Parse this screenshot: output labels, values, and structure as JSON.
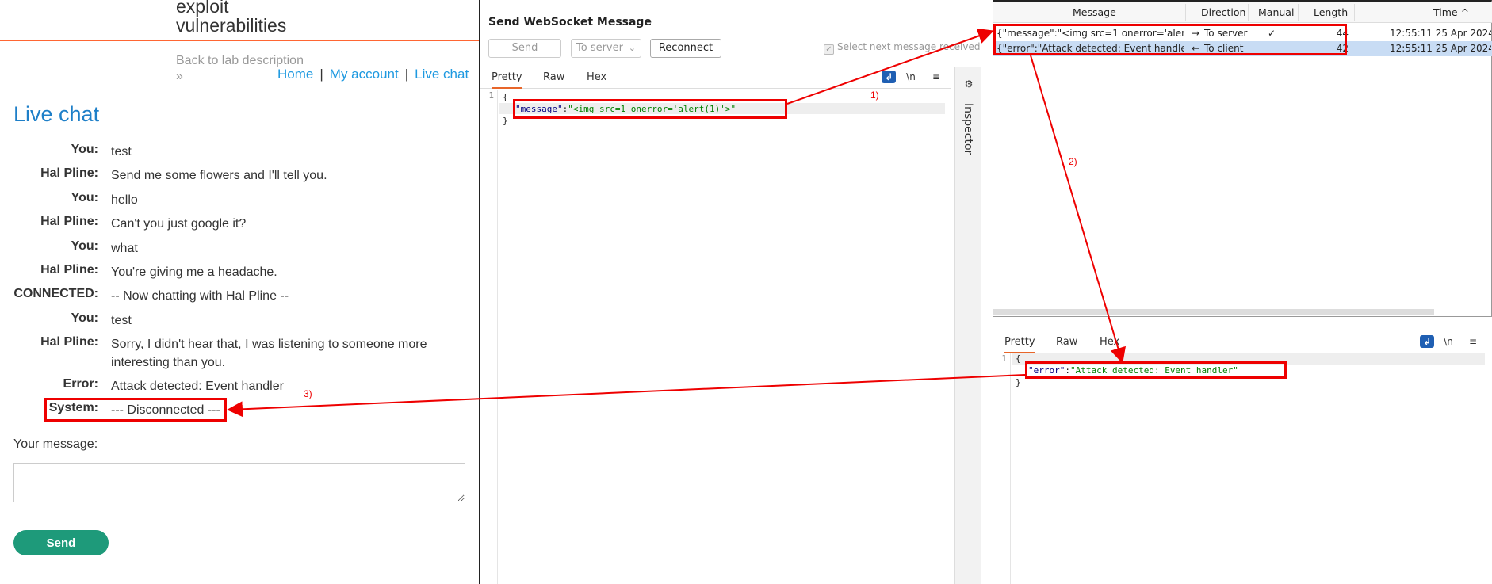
{
  "chat_page": {
    "lab_title_line1": "exploit",
    "lab_title_line2": "vulnerabilities",
    "back_link": "Back to lab description",
    "back_chevron": "»",
    "nav": {
      "home": "Home",
      "my_account": "My account",
      "live_chat": "Live chat",
      "separator": "|"
    },
    "live_chat_heading": "Live chat",
    "messages": [
      {
        "who": "You:",
        "text": "test"
      },
      {
        "who": "Hal Pline:",
        "text": "Send me some flowers and I'll tell you."
      },
      {
        "who": "You:",
        "text": "hello"
      },
      {
        "who": "Hal Pline:",
        "text": "Can't you just google it?"
      },
      {
        "who": "You:",
        "text": "what"
      },
      {
        "who": "Hal Pline:",
        "text": "You're giving me a headache."
      },
      {
        "who": "CONNECTED:",
        "text": "-- Now chatting with Hal Pline --"
      },
      {
        "who": "You:",
        "text": "test"
      },
      {
        "who": "Hal Pline:",
        "text": "Sorry, I didn't hear that, I was listening to someone more interesting than you."
      },
      {
        "who": "Error:",
        "text": "Attack detected: Event handler"
      },
      {
        "who": "System:",
        "text": "--- Disconnected ---"
      }
    ],
    "your_message_label": "Your message:",
    "send_button": "Send"
  },
  "ws_panel": {
    "title": "Send WebSocket Message",
    "send_button": "Send",
    "direction_select": "To server",
    "reconnect_button": "Reconnect",
    "select_next_checkbox": "Select next message received",
    "tabs": [
      "Pretty",
      "Raw",
      "Hex"
    ],
    "wrap_icon": "\\n",
    "menu_icon": "≡",
    "inspector_label": "Inspector",
    "line_numbers": [
      "1"
    ],
    "code_open": "{",
    "code_key": "\"message\"",
    "code_colon": ":",
    "code_value": "\"<img src=1 onerror='alert(1)'>\"",
    "code_close": "}"
  },
  "history": {
    "columns": [
      "Message",
      "Direction",
      "Manual",
      "Length",
      "Time"
    ],
    "sort_indicator": "^",
    "rows": [
      {
        "message": "{\"message\":\"<img src=1 onerror='aler...",
        "direction_arrow": "→",
        "direction": "To server",
        "manual": "✓",
        "length": "44",
        "time": "12:55:11 25 Apr 2024"
      },
      {
        "message": "{\"error\":\"Attack detected: Event handle...",
        "direction_arrow": "←",
        "direction": "To client",
        "manual": "",
        "length": "42",
        "time": "12:55:11 25 Apr 2024"
      }
    ]
  },
  "response": {
    "tabs": [
      "Pretty",
      "Raw",
      "Hex"
    ],
    "wrap_icon": "\\n",
    "menu_icon": "≡",
    "line_numbers": [
      "1"
    ],
    "code_open": "{",
    "code_key": "\"error\"",
    "code_colon": ":",
    "code_value": "\"Attack detected: Event handler\"",
    "code_close": "}"
  },
  "annotations": {
    "step1": "1)",
    "step2": "2)",
    "step3": "3)"
  },
  "colors": {
    "accent_orange": "#ff6633",
    "link_blue": "#1e99e0",
    "heading_blue": "#1e7fc8",
    "send_green": "#1e9a7a",
    "annotation_red": "#ee0000",
    "selected_row": "#c8dcf4"
  }
}
